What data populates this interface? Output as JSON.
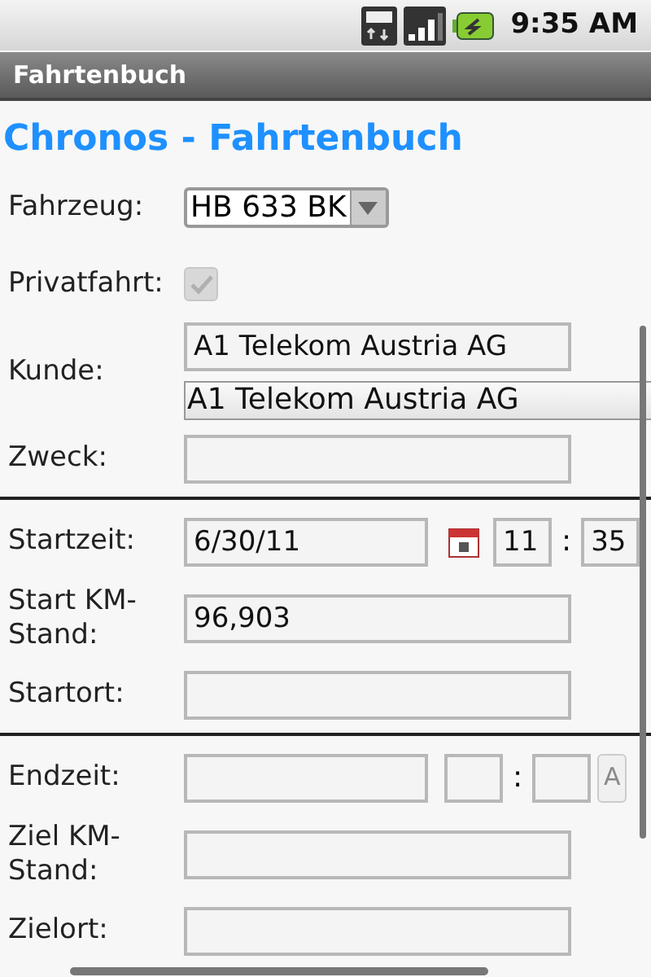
{
  "status_bar": {
    "time": "9:35 AM"
  },
  "title_bar": {
    "title": "Fahrtenbuch"
  },
  "heading": "Chronos - Fahrtenbuch",
  "sections": [
    {
      "rows": [
        {
          "kind": "spinner",
          "label": "Fahrzeug:",
          "value": "HB 633 BK"
        },
        {
          "kind": "checkbox",
          "label": "Privatfahrt:",
          "checked": true,
          "disabled": true
        },
        {
          "kind": "autocomplete",
          "label": "Kunde:",
          "value": "A1 Telekom Austria AG",
          "suggestion": "A1 Telekom Austria AG"
        },
        {
          "kind": "text",
          "label": "Zweck:"
        }
      ]
    },
    {
      "rows": [
        {
          "kind": "datetime",
          "label": "Startzeit:",
          "date": "6/30/11",
          "hour": "11",
          "separator": ":",
          "minute": "35"
        },
        {
          "kind": "text",
          "label": "Start KM-Stand:",
          "value": "96,903"
        },
        {
          "kind": "text",
          "label": "Startort:"
        }
      ]
    },
    {
      "rows": [
        {
          "kind": "datetime",
          "label": "Endzeit:",
          "separator": ":",
          "ampm": "A"
        },
        {
          "kind": "text",
          "label": "Ziel KM-Stand:"
        },
        {
          "kind": "text",
          "label": "Zielort:"
        }
      ]
    }
  ]
}
